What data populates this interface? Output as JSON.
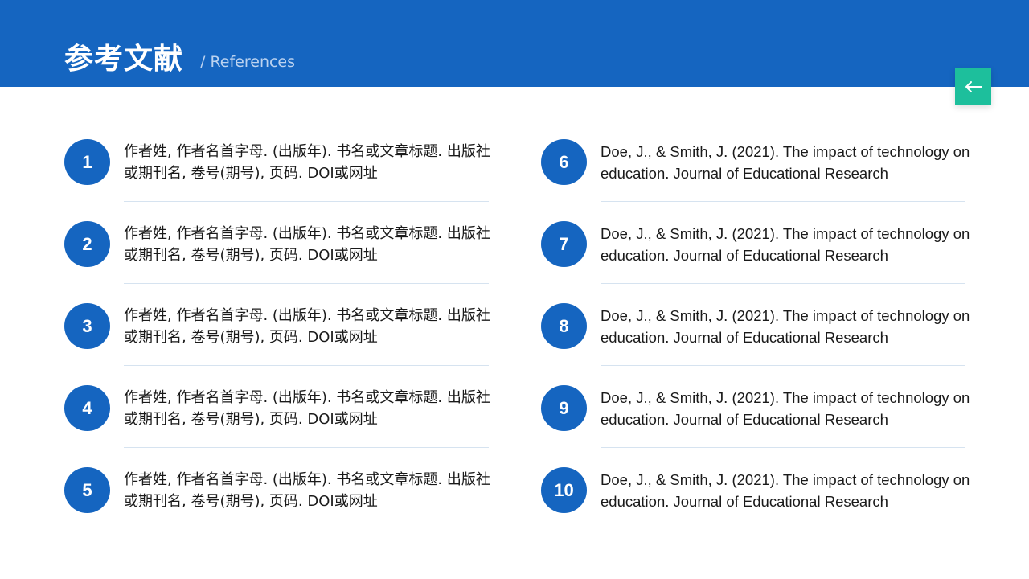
{
  "header": {
    "title": "参考文献",
    "subtitle": "/ References"
  },
  "back_button": {
    "icon": "arrow-left-icon",
    "color": "#1dbf9c"
  },
  "colors": {
    "primary": "#1565c0",
    "accent": "#1dbf9c"
  },
  "references_left": [
    {
      "num": "1",
      "text": "作者姓, 作者名首字母. (出版年). 书名或文章标题. 出版社或期刊名, 卷号(期号), 页码. DOI或网址"
    },
    {
      "num": "2",
      "text": "作者姓, 作者名首字母. (出版年). 书名或文章标题. 出版社或期刊名, 卷号(期号), 页码. DOI或网址"
    },
    {
      "num": "3",
      "text": "作者姓, 作者名首字母. (出版年). 书名或文章标题. 出版社或期刊名, 卷号(期号), 页码. DOI或网址"
    },
    {
      "num": "4",
      "text": "作者姓, 作者名首字母. (出版年). 书名或文章标题. 出版社或期刊名, 卷号(期号), 页码. DOI或网址"
    },
    {
      "num": "5",
      "text": "作者姓, 作者名首字母. (出版年). 书名或文章标题. 出版社或期刊名, 卷号(期号), 页码. DOI或网址"
    }
  ],
  "references_right": [
    {
      "num": "6",
      "text": "Doe, J., & Smith, J. (2021). The impact of technology on education. Journal of Educational Research"
    },
    {
      "num": "7",
      "text": "Doe, J., & Smith, J. (2021). The impact of technology on education. Journal of Educational Research"
    },
    {
      "num": "8",
      "text": "Doe, J., & Smith, J. (2021). The impact of technology on education. Journal of Educational Research"
    },
    {
      "num": "9",
      "text": "Doe, J., & Smith, J. (2021). The impact of technology on education. Journal of Educational Research"
    },
    {
      "num": "10",
      "text": "Doe, J., & Smith, J. (2021). The impact of technology on education. Journal of Educational Research"
    }
  ]
}
